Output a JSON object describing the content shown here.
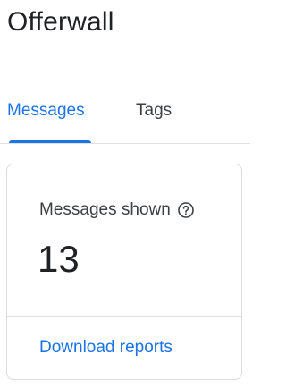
{
  "page": {
    "title": "Offerwall"
  },
  "tabs": [
    {
      "label": "Messages",
      "active": true
    },
    {
      "label": "Tags",
      "active": false
    }
  ],
  "card": {
    "metric_label": "Messages shown",
    "help_icon": "help-circle-icon",
    "metric_value": "13",
    "link_label": "Download reports"
  },
  "colors": {
    "accent": "#1a73e8",
    "text": "#202124",
    "border": "#dadce0"
  }
}
